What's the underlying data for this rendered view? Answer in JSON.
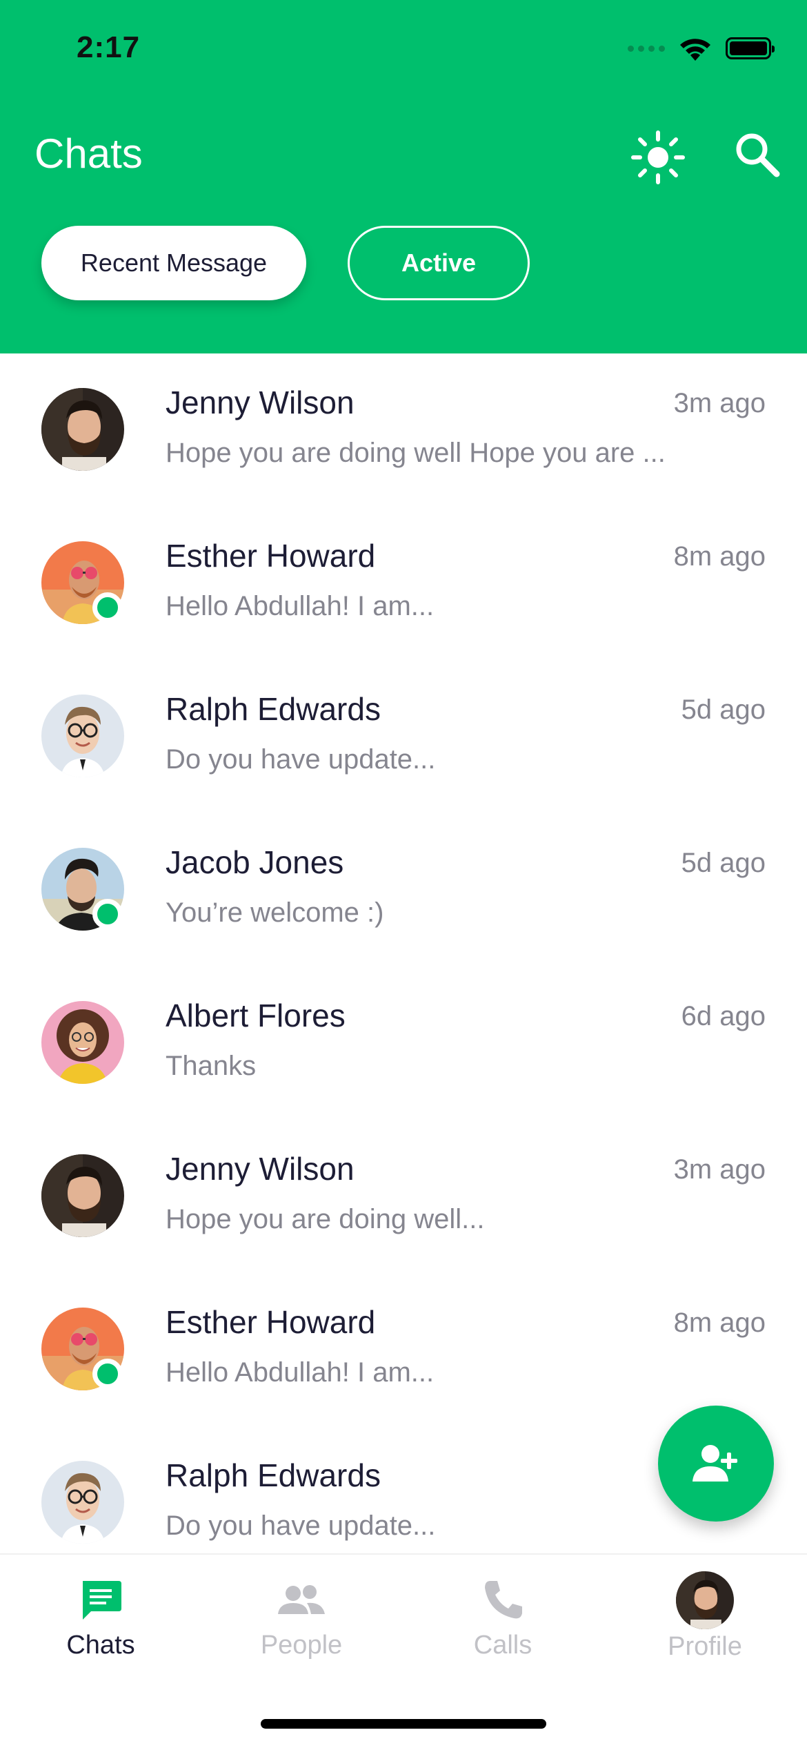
{
  "status_bar": {
    "time": "2:17"
  },
  "header": {
    "title": "Chats",
    "theme_icon": "sun-icon",
    "search_icon": "search-icon"
  },
  "filters": {
    "recent_label": "Recent Message",
    "active_label": "Active",
    "selected": "Recent Message"
  },
  "chats": [
    {
      "name": "Jenny Wilson",
      "message": "Hope you are doing well Hope you are ...",
      "time": "3m ago",
      "online": false,
      "avatar": "beard-man"
    },
    {
      "name": "Esther Howard",
      "message": "Hello Abdullah! I am...",
      "time": "8m ago",
      "online": true,
      "avatar": "sunglasses-man"
    },
    {
      "name": "Ralph Edwards",
      "message": "Do you have update...",
      "time": "5d ago",
      "online": false,
      "avatar": "glasses-man"
    },
    {
      "name": "Jacob Jones",
      "message": "You’re welcome :)",
      "time": "5d ago",
      "online": true,
      "avatar": "stylish-man"
    },
    {
      "name": "Albert Flores",
      "message": "Thanks",
      "time": "6d ago",
      "online": false,
      "avatar": "curly-woman"
    },
    {
      "name": "Jenny Wilson",
      "message": "Hope you are doing well...",
      "time": "3m ago",
      "online": false,
      "avatar": "beard-man"
    },
    {
      "name": "Esther Howard",
      "message": "Hello Abdullah! I am...",
      "time": "8m ago",
      "online": true,
      "avatar": "sunglasses-man"
    },
    {
      "name": "Ralph Edwards",
      "message": "Do you have update...",
      "time": "",
      "online": false,
      "avatar": "glasses-man"
    }
  ],
  "fab": {
    "icon": "add-person-icon"
  },
  "tabbar": {
    "chats": "Chats",
    "people": "People",
    "calls": "Calls",
    "profile": "Profile",
    "selected": "Chats"
  },
  "colors": {
    "primary": "#00BF6D",
    "text": "#1D1D35",
    "muted": "#85858F",
    "inactive": "#C1C1C6"
  }
}
